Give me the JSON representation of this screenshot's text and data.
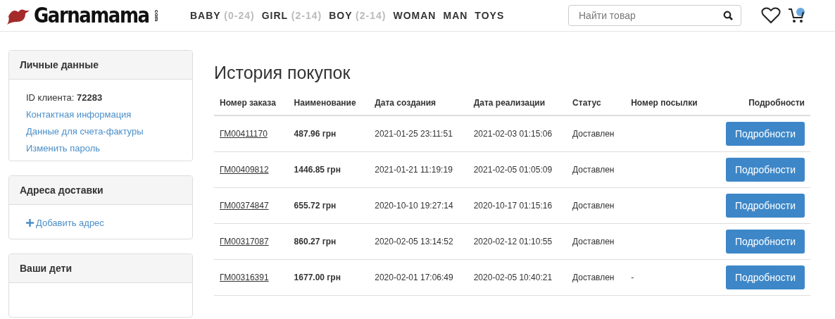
{
  "header": {
    "logo": {
      "name": "Garnamama",
      "suffix": "com"
    },
    "nav": [
      {
        "label": "BABY",
        "range": "(0-24)"
      },
      {
        "label": "GIRL",
        "range": "(2-14)"
      },
      {
        "label": "BOY",
        "range": "(2-14)"
      },
      {
        "label": "WOMAN"
      },
      {
        "label": "MAN"
      },
      {
        "label": "TOYS"
      }
    ],
    "search": {
      "placeholder": "Найти товар"
    }
  },
  "sidebar": [
    {
      "title": "Личные данные",
      "items": [
        {
          "kind": "text",
          "text": "ID клиента: **72283**"
        },
        {
          "kind": "link",
          "text": "Контактная информация"
        },
        {
          "kind": "link",
          "text": "Данные для счета-фактуры"
        },
        {
          "kind": "link",
          "text": "Изменить пароль"
        }
      ]
    },
    {
      "title": "Адреса доставки",
      "items": [
        {
          "kind": "add",
          "text": "Добавить адрес"
        }
      ]
    },
    {
      "title": "Ваши дети"
    }
  ],
  "main": {
    "title": "История покупок",
    "columns": [
      "Номер заказа",
      "Наименование",
      "Дата создания",
      "Дата реализации",
      "Статус",
      "Номер посылки",
      "Подробности"
    ],
    "rows": [
      {
        "order": "ГМ00411170",
        "amount": "487.96 грн",
        "created": "2021-01-25 23:11:51",
        "completed": "2021-02-03 01:15:06",
        "status": "Доставлен",
        "button": "Подробности"
      },
      {
        "order": "ГМ00409812",
        "amount": "1446.85 грн",
        "created": "2021-01-21 11:19:19",
        "completed": "2021-02-05 01:05:09",
        "status": "Доставлен",
        "button": "Подробности"
      },
      {
        "order": "ГМ00374847",
        "amount": "655.72 грн",
        "created": "2020-10-10 19:27:14",
        "completed": "2020-10-17 01:15:16",
        "status": "Доставлен",
        "button": "Подробности"
      },
      {
        "order": "ГМ00317087",
        "amount": "860.27 грн",
        "created": "2020-02-05 13:14:52",
        "completed": "2020-02-12 01:10:55",
        "status": "Доставлен",
        "button": "Подробности"
      },
      {
        "order": "ГМ00316391",
        "amount": "1677.00 грн",
        "created": "2020-02-01 17:06:49",
        "completed": "2020-02-05 10:40:21",
        "status": "Доставлен",
        "parcel": "-",
        "button": "Подробности"
      }
    ]
  }
}
